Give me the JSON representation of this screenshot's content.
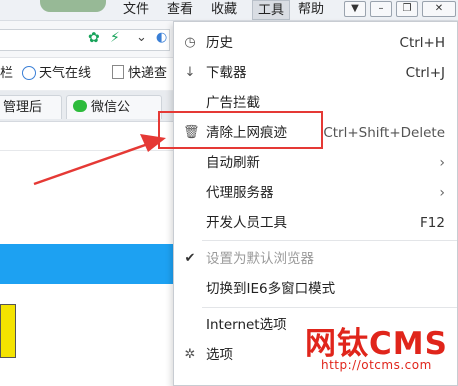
{
  "menubar": {
    "items": [
      {
        "label": "文件"
      },
      {
        "label": "查看"
      },
      {
        "label": "收藏"
      },
      {
        "label": "工具"
      },
      {
        "label": "帮助"
      }
    ]
  },
  "toolbar": {
    "address_value": ""
  },
  "favorites": {
    "items": [
      {
        "label": "栏"
      },
      {
        "label": "天气在线"
      },
      {
        "label": "快递查"
      }
    ]
  },
  "tabs": [
    {
      "label": "管理后"
    },
    {
      "label": "微信公"
    }
  ],
  "tools_menu": {
    "items": [
      {
        "label": "历史",
        "shortcut": "Ctrl+H",
        "icon": "clock-icon",
        "disabled": false
      },
      {
        "label": "下载器",
        "shortcut": "Ctrl+J",
        "icon": "download-icon",
        "disabled": false
      },
      {
        "label": "广告拦截",
        "shortcut": "",
        "icon": "",
        "disabled": false
      },
      {
        "label": "清除上网痕迹",
        "shortcut": "Ctrl+Shift+Delete",
        "icon": "trash-icon",
        "disabled": false
      },
      {
        "label": "自动刷新",
        "shortcut": "",
        "icon": "",
        "submenu": true
      },
      {
        "label": "代理服务器",
        "shortcut": "",
        "icon": "",
        "submenu": true
      },
      {
        "label": "开发人员工具",
        "shortcut": "F12",
        "icon": "",
        "disabled": false
      },
      {
        "label": "设置为默认浏览器",
        "shortcut": "",
        "icon": "check-icon",
        "disabled": true
      },
      {
        "label": "切换到IE6多窗口模式",
        "shortcut": "",
        "icon": "",
        "disabled": false
      },
      {
        "label": "Internet选项",
        "shortcut": "",
        "icon": "",
        "disabled": false
      },
      {
        "label": "选项",
        "shortcut": "",
        "icon": "gear-icon",
        "disabled": false
      }
    ]
  },
  "watermark": {
    "title": "网钛CMS",
    "url": "http://otcms.com"
  },
  "colors": {
    "accent_red": "#e53935",
    "blue_bar": "#1da1f2",
    "watermark": "#e0251b"
  }
}
